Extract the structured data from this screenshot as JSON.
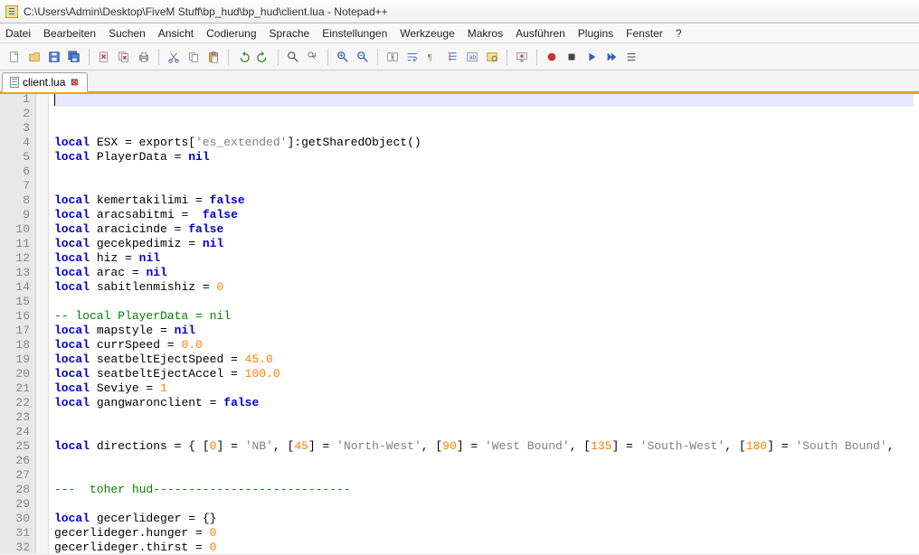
{
  "window": {
    "title": "C:\\Users\\Admin\\Desktop\\FiveM Stuff\\bp_hud\\bp_hud\\client.lua - Notepad++"
  },
  "menu": {
    "items": [
      "Datei",
      "Bearbeiten",
      "Suchen",
      "Ansicht",
      "Codierung",
      "Sprache",
      "Einstellungen",
      "Werkzeuge",
      "Makros",
      "Ausführen",
      "Plugins",
      "Fenster",
      "?"
    ]
  },
  "tabs": {
    "active": {
      "label": "client.lua"
    }
  },
  "toolbar": {
    "icons": [
      "new",
      "open",
      "save",
      "saveall",
      "close",
      "closeall",
      "print",
      "cut",
      "copy",
      "paste",
      "undo",
      "redo",
      "find",
      "replace",
      "zoomin",
      "zoomout",
      "sync",
      "wrap",
      "allchars",
      "indentguide",
      "lang",
      "folder",
      "monitor",
      "record",
      "stop",
      "play",
      "playmulti",
      "list"
    ]
  },
  "code": {
    "lines": [
      {
        "n": 1,
        "current": true,
        "tokens": []
      },
      {
        "n": 2,
        "tokens": []
      },
      {
        "n": 3,
        "tokens": []
      },
      {
        "n": 4,
        "tokens": [
          {
            "t": "kw",
            "v": "local"
          },
          {
            "t": "sp",
            "v": " "
          },
          {
            "t": "ident",
            "v": "ESX = exports["
          },
          {
            "t": "str",
            "v": "'es_extended'"
          },
          {
            "t": "ident",
            "v": "]:getSharedObject()"
          }
        ]
      },
      {
        "n": 5,
        "tokens": [
          {
            "t": "kw",
            "v": "local"
          },
          {
            "t": "sp",
            "v": " "
          },
          {
            "t": "ident",
            "v": "PlayerData = "
          },
          {
            "t": "bool",
            "v": "nil"
          }
        ]
      },
      {
        "n": 6,
        "tokens": []
      },
      {
        "n": 7,
        "tokens": []
      },
      {
        "n": 8,
        "tokens": [
          {
            "t": "kw",
            "v": "local"
          },
          {
            "t": "sp",
            "v": " "
          },
          {
            "t": "ident",
            "v": "kemertakilimi = "
          },
          {
            "t": "bool",
            "v": "false"
          }
        ]
      },
      {
        "n": 9,
        "tokens": [
          {
            "t": "kw",
            "v": "local"
          },
          {
            "t": "sp",
            "v": " "
          },
          {
            "t": "ident",
            "v": "aracsabitmi =  "
          },
          {
            "t": "bool",
            "v": "false"
          }
        ]
      },
      {
        "n": 10,
        "tokens": [
          {
            "t": "kw",
            "v": "local"
          },
          {
            "t": "sp",
            "v": " "
          },
          {
            "t": "ident",
            "v": "aracicinde = "
          },
          {
            "t": "bool",
            "v": "false"
          }
        ]
      },
      {
        "n": 11,
        "tokens": [
          {
            "t": "kw",
            "v": "local"
          },
          {
            "t": "sp",
            "v": " "
          },
          {
            "t": "ident",
            "v": "gecekpedimiz = "
          },
          {
            "t": "bool",
            "v": "nil"
          }
        ]
      },
      {
        "n": 12,
        "tokens": [
          {
            "t": "kw",
            "v": "local"
          },
          {
            "t": "sp",
            "v": " "
          },
          {
            "t": "ident",
            "v": "hiz = "
          },
          {
            "t": "bool",
            "v": "nil"
          }
        ]
      },
      {
        "n": 13,
        "tokens": [
          {
            "t": "kw",
            "v": "local"
          },
          {
            "t": "sp",
            "v": " "
          },
          {
            "t": "ident",
            "v": "arac = "
          },
          {
            "t": "bool",
            "v": "nil"
          }
        ]
      },
      {
        "n": 14,
        "tokens": [
          {
            "t": "kw",
            "v": "local"
          },
          {
            "t": "sp",
            "v": " "
          },
          {
            "t": "ident",
            "v": "sabitlenmishiz = "
          },
          {
            "t": "num",
            "v": "0"
          }
        ]
      },
      {
        "n": 15,
        "tokens": []
      },
      {
        "n": 16,
        "tokens": [
          {
            "t": "cmt",
            "v": "-- local PlayerData = nil"
          }
        ]
      },
      {
        "n": 17,
        "tokens": [
          {
            "t": "kw",
            "v": "local"
          },
          {
            "t": "sp",
            "v": " "
          },
          {
            "t": "ident",
            "v": "mapstyle = "
          },
          {
            "t": "bool",
            "v": "nil"
          }
        ]
      },
      {
        "n": 18,
        "tokens": [
          {
            "t": "kw",
            "v": "local"
          },
          {
            "t": "sp",
            "v": " "
          },
          {
            "t": "ident",
            "v": "currSpeed = "
          },
          {
            "t": "num",
            "v": "0.0"
          }
        ]
      },
      {
        "n": 19,
        "tokens": [
          {
            "t": "kw",
            "v": "local"
          },
          {
            "t": "sp",
            "v": " "
          },
          {
            "t": "ident",
            "v": "seatbeltEjectSpeed = "
          },
          {
            "t": "num",
            "v": "45.0"
          }
        ]
      },
      {
        "n": 20,
        "tokens": [
          {
            "t": "kw",
            "v": "local"
          },
          {
            "t": "sp",
            "v": " "
          },
          {
            "t": "ident",
            "v": "seatbeltEjectAccel = "
          },
          {
            "t": "num",
            "v": "100.0"
          }
        ]
      },
      {
        "n": 21,
        "tokens": [
          {
            "t": "kw",
            "v": "local"
          },
          {
            "t": "sp",
            "v": " "
          },
          {
            "t": "ident",
            "v": "Seviye = "
          },
          {
            "t": "num",
            "v": "1"
          }
        ]
      },
      {
        "n": 22,
        "tokens": [
          {
            "t": "kw",
            "v": "local"
          },
          {
            "t": "sp",
            "v": " "
          },
          {
            "t": "ident",
            "v": "gangwaronclient = "
          },
          {
            "t": "bool",
            "v": "false"
          }
        ]
      },
      {
        "n": 23,
        "tokens": []
      },
      {
        "n": 24,
        "tokens": []
      },
      {
        "n": 25,
        "tokens": [
          {
            "t": "kw",
            "v": "local"
          },
          {
            "t": "sp",
            "v": " "
          },
          {
            "t": "ident",
            "v": "directions = { ["
          },
          {
            "t": "num",
            "v": "0"
          },
          {
            "t": "ident",
            "v": "] = "
          },
          {
            "t": "str",
            "v": "'NB'"
          },
          {
            "t": "ident",
            "v": ", ["
          },
          {
            "t": "num",
            "v": "45"
          },
          {
            "t": "ident",
            "v": "] = "
          },
          {
            "t": "str",
            "v": "'North-West'"
          },
          {
            "t": "ident",
            "v": ", ["
          },
          {
            "t": "num",
            "v": "90"
          },
          {
            "t": "ident",
            "v": "] = "
          },
          {
            "t": "str",
            "v": "'West Bound'"
          },
          {
            "t": "ident",
            "v": ", ["
          },
          {
            "t": "num",
            "v": "135"
          },
          {
            "t": "ident",
            "v": "] = "
          },
          {
            "t": "str",
            "v": "'South-West'"
          },
          {
            "t": "ident",
            "v": ", ["
          },
          {
            "t": "num",
            "v": "180"
          },
          {
            "t": "ident",
            "v": "] = "
          },
          {
            "t": "str",
            "v": "'South Bound'"
          },
          {
            "t": "ident",
            "v": ","
          }
        ]
      },
      {
        "n": 26,
        "tokens": []
      },
      {
        "n": 27,
        "tokens": []
      },
      {
        "n": 28,
        "tokens": [
          {
            "t": "cmt",
            "v": "---  toher hud----------------------------"
          }
        ]
      },
      {
        "n": 29,
        "tokens": []
      },
      {
        "n": 30,
        "tokens": [
          {
            "t": "kw",
            "v": "local"
          },
          {
            "t": "sp",
            "v": " "
          },
          {
            "t": "ident",
            "v": "gecerlideger = {}"
          }
        ]
      },
      {
        "n": 31,
        "tokens": [
          {
            "t": "ident",
            "v": "gecerlideger.hunger = "
          },
          {
            "t": "num",
            "v": "0"
          }
        ]
      },
      {
        "n": 32,
        "tokens": [
          {
            "t": "ident",
            "v": "gecerlideger.thirst = "
          },
          {
            "t": "num",
            "v": "0"
          }
        ]
      }
    ]
  }
}
